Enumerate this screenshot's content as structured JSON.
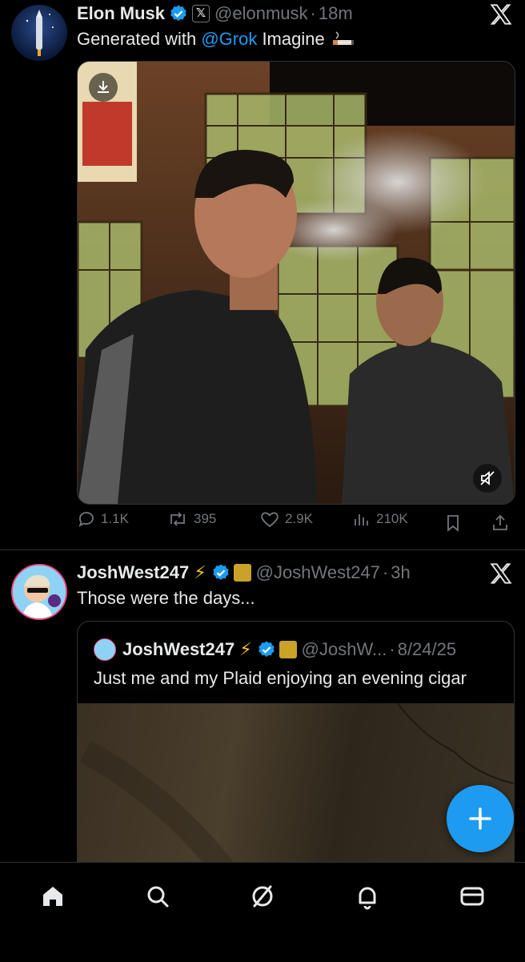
{
  "posts": [
    {
      "author": "Elon Musk",
      "handle": "@elonmusk",
      "sep": "·",
      "time": "18m",
      "text_before": "Generated with ",
      "mention": "@Grok",
      "text_after": " Imagine",
      "actions": {
        "replies": "1.1K",
        "reposts": "395",
        "likes": "2.9K",
        "views": "210K"
      }
    },
    {
      "author": "JoshWest247",
      "handle": "@JoshWest247",
      "sep": "·",
      "time": "3h",
      "text": "Those were the days...",
      "quote": {
        "author": "JoshWest247",
        "handle": "@JoshW...",
        "sep": "·",
        "time": "8/24/25",
        "text": "Just me and my Plaid enjoying an evening cigar"
      }
    }
  ],
  "nav": [
    "home-icon",
    "search-icon",
    "grok-icon",
    "notifications-icon",
    "messages-icon"
  ],
  "colors": {
    "accent": "#1d9bf0",
    "background": "#000000",
    "text": "#e7e9ea",
    "muted": "#71767b"
  }
}
